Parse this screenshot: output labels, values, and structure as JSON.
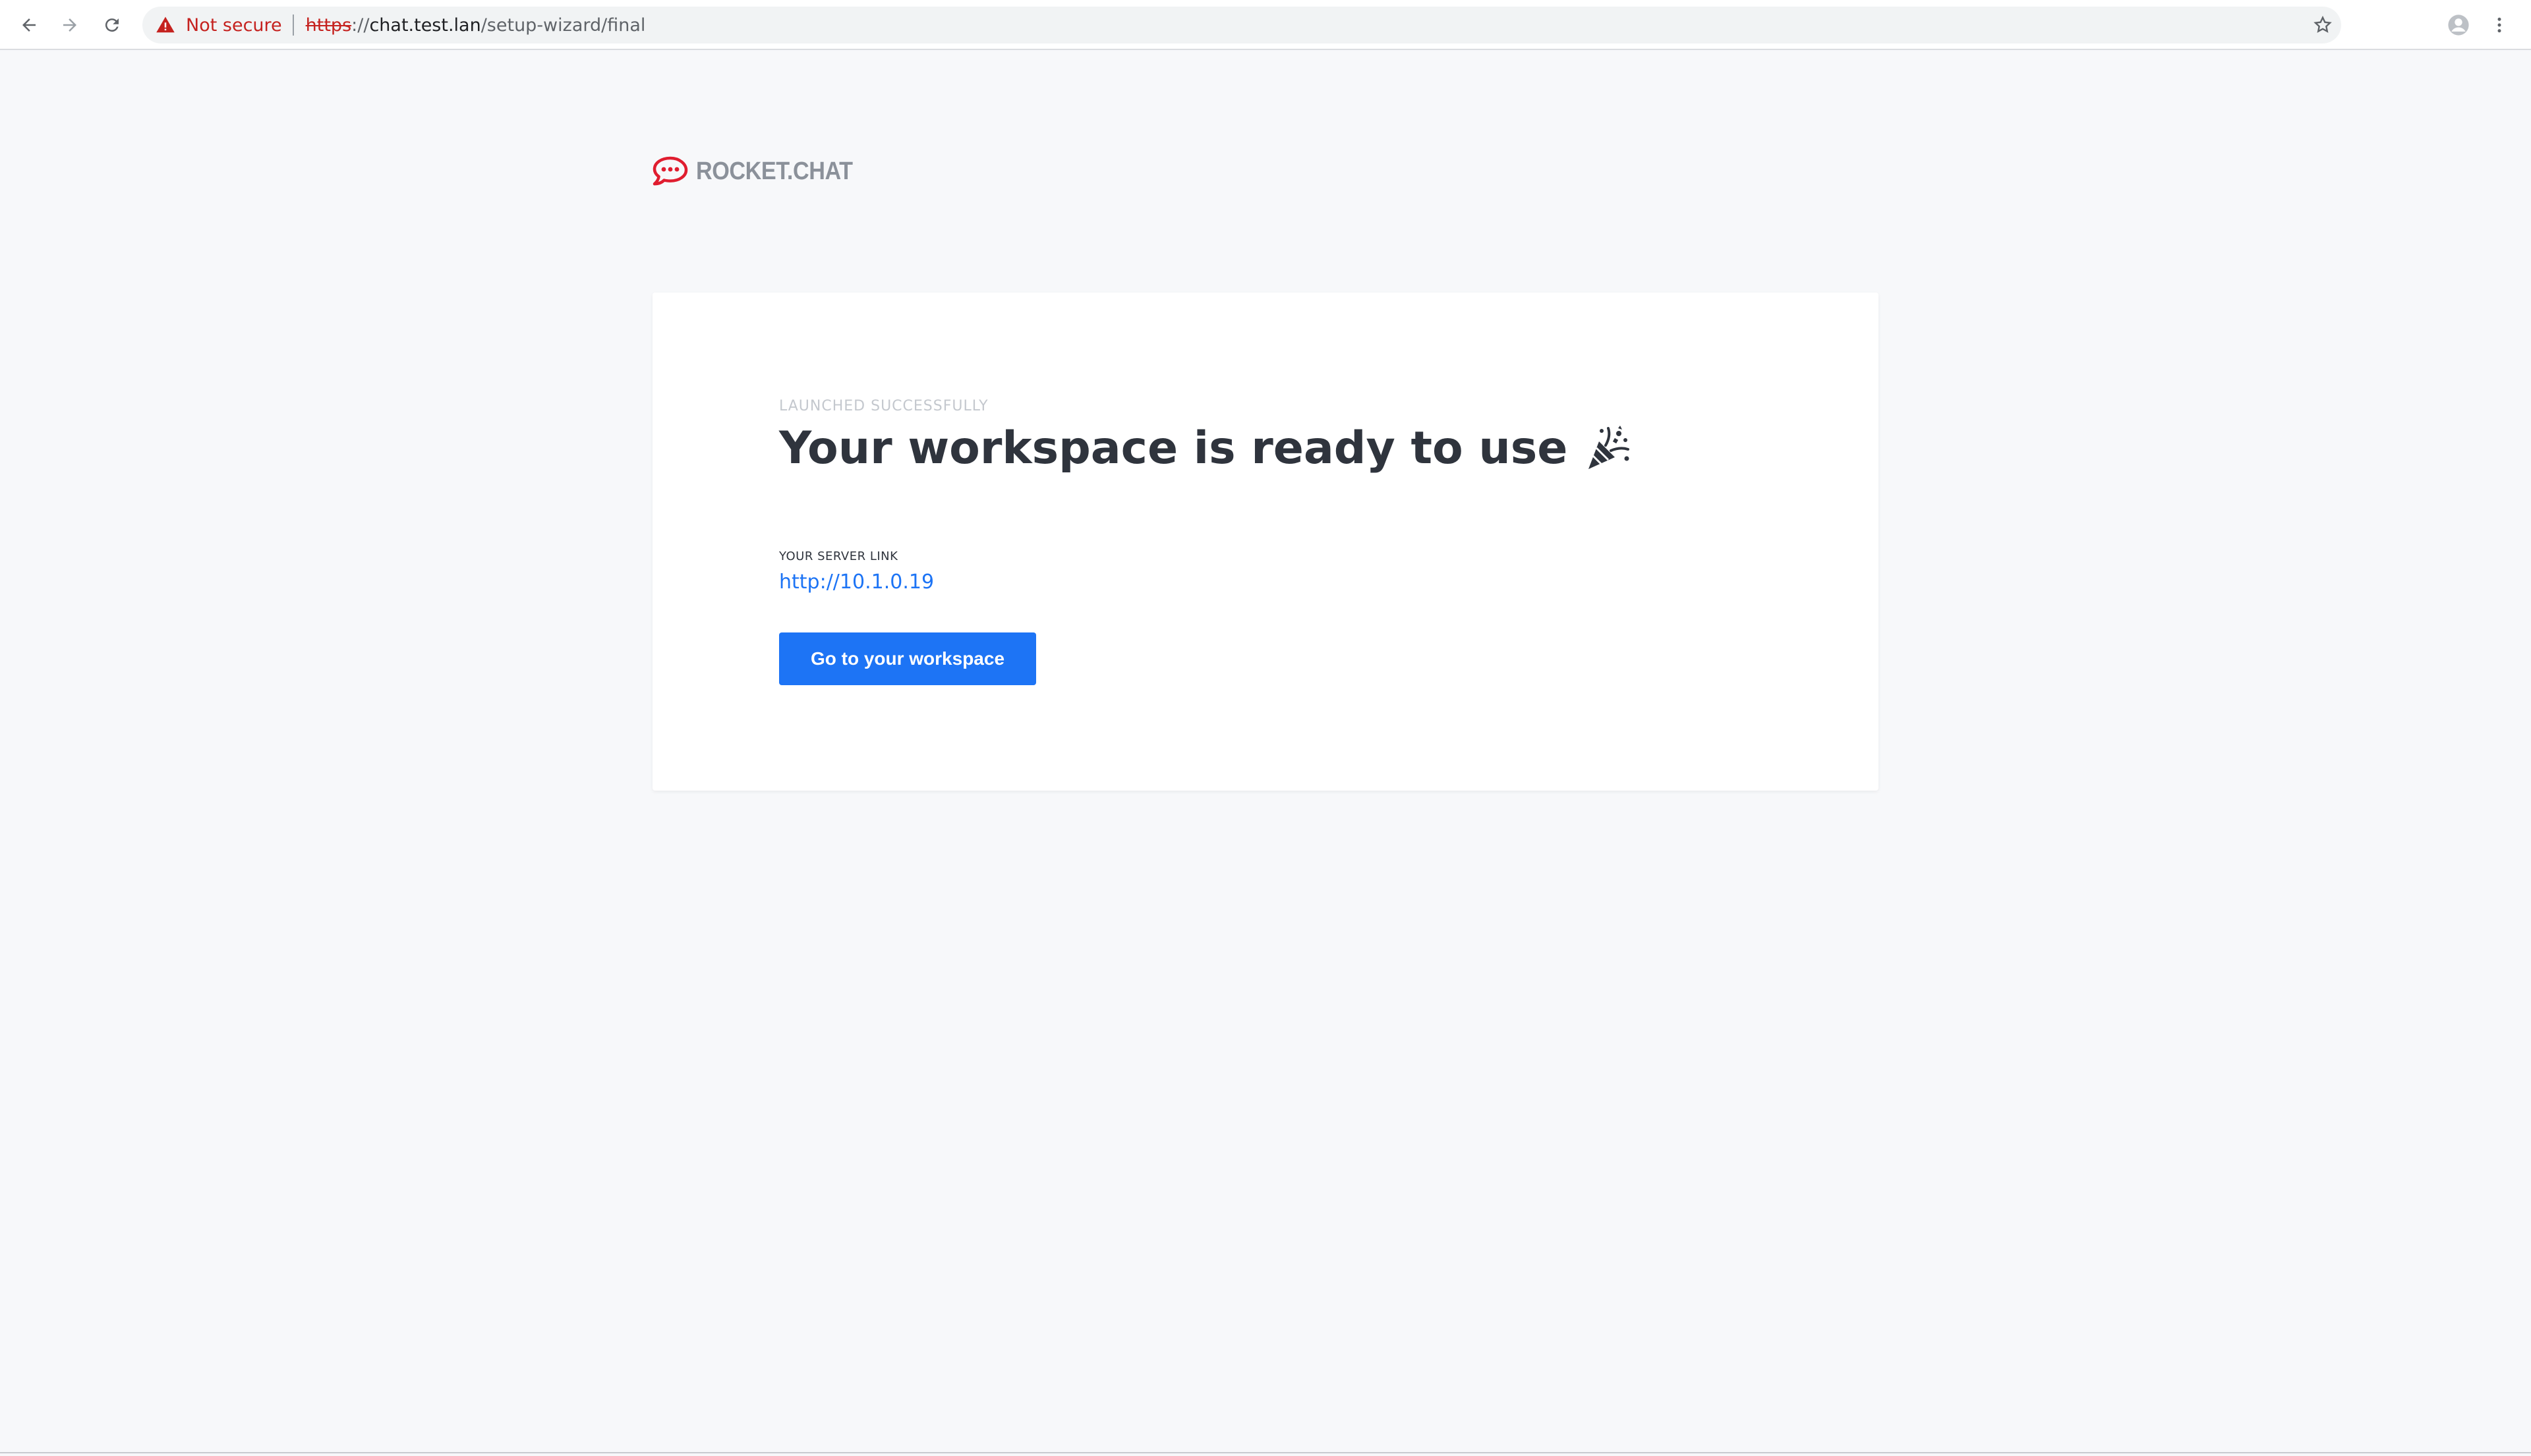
{
  "browser": {
    "security_label": "Not secure",
    "url_scheme": "https",
    "url_sep": "://",
    "url_host": "chat.test.lan",
    "url_path": "/setup-wizard/final",
    "icons": {
      "back": "back-arrow-icon",
      "forward": "forward-arrow-icon",
      "reload": "reload-icon",
      "warning": "warning-triangle-icon",
      "star": "star-icon",
      "profile": "profile-icon",
      "menu": "kebab-menu-icon"
    }
  },
  "brand": {
    "logo_text": "ROCKET.CHAT",
    "logo_color": "#e01d2f"
  },
  "card": {
    "eyebrow": "LAUNCHED SUCCESSFULLY",
    "headline": "Your workspace is ready to use",
    "headline_icon": "party-popper-icon",
    "server_label": "YOUR SERVER LINK",
    "server_link": "http://10.1.0.19",
    "cta_label": "Go to your workspace"
  },
  "colors": {
    "accent": "#1d74f5",
    "background": "#f7f8fa",
    "card": "#ffffff",
    "warning": "#c5221f"
  }
}
